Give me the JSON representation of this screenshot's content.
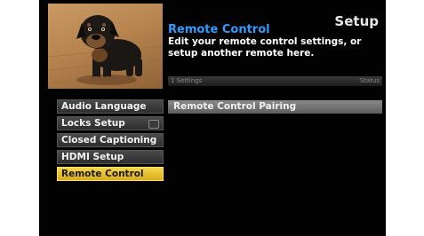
{
  "header": {
    "setup_title": "Setup",
    "section_title": "Remote Control",
    "description": "Edit your remote control settings, or setup another remote here."
  },
  "info_bar": {
    "left": "1 Settings",
    "right": "Status"
  },
  "menu": {
    "items": [
      {
        "label": "Audio Language"
      },
      {
        "label": "Locks Setup",
        "icon": "lock-icon"
      },
      {
        "label": "Closed Captioning"
      },
      {
        "label": "HDMI Setup"
      },
      {
        "label": "Remote Control",
        "selected": true
      }
    ]
  },
  "submenu": {
    "items": [
      {
        "label": "Remote Control Pairing"
      }
    ]
  },
  "colors": {
    "accent_title": "#2f9bff",
    "selected_item": "#f0c533",
    "background": "#020202"
  }
}
